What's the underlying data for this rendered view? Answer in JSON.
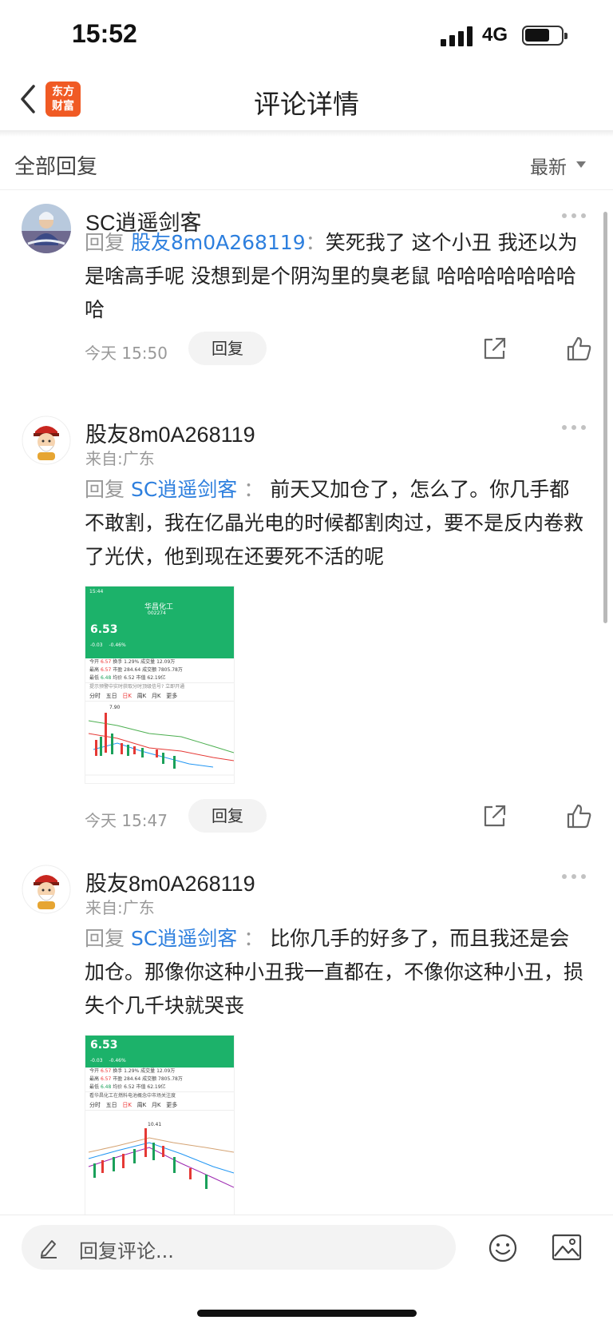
{
  "status_bar": {
    "time": "15:52",
    "network": "4G"
  },
  "nav": {
    "logo_line1": "东方",
    "logo_line2": "财富",
    "title": "评论详情"
  },
  "filter": {
    "all_label": "全部回复",
    "sort_label": "最新"
  },
  "comments": [
    {
      "username": "SC逍遥剑客",
      "location": "",
      "reply_prefix": "回复",
      "reply_target": "股友8m0A268119",
      "separator": "：",
      "text": "笑死我了 这个小丑 我还以为是啥高手呢 没想到是个阴沟里的臭老鼠 哈哈哈哈哈哈哈哈",
      "time": "今天 15:50",
      "reply_button": "回复"
    },
    {
      "username": "股友8m0A268119",
      "location": "来自:广东",
      "reply_prefix": "回复",
      "reply_target": "SC逍遥剑客",
      "separator": "：",
      "text": "前天又加仓了，怎么了。你几手都不敢割，我在亿晶光电的时候都割肉过，要不是反内卷救了光伏，他到现在还要死不活的呢",
      "time": "今天 15:47",
      "reply_button": "回复",
      "image": {
        "status_time": "15:44",
        "stock_name": "华昌化工",
        "stock_code": "002274",
        "price": "6.53",
        "change": "-0.03",
        "change_pct": "-0.46%",
        "rows": [
          [
            "今开",
            "6.57",
            "换手",
            "1.29%",
            "成交量",
            "12.09万"
          ],
          [
            "最高",
            "6.57",
            "市盈",
            "284.64",
            "成交额",
            "7805.78万"
          ],
          [
            "最低",
            "6.48",
            "均价",
            "6.52",
            "市值",
            "62.19亿"
          ]
        ],
        "notice": "提示预警中实时获取分时顶级信号? 立即开通",
        "tabs": [
          "分时",
          "五日",
          "日K",
          "周K",
          "月K",
          "更多"
        ],
        "peak": "7.90"
      }
    },
    {
      "username": "股友8m0A268119",
      "location": "来自:广东",
      "reply_prefix": "回复",
      "reply_target": "SC逍遥剑客",
      "separator": "：",
      "text": "比你几手的好多了，而且我还是会加仓。那像你这种小丑我一直都在，不像你这种小丑，损失个几千块就哭丧",
      "image": {
        "price": "6.53",
        "change": "-0.03",
        "change_pct": "-0.46%",
        "rows": [
          [
            "今开",
            "6.57",
            "换手",
            "1.29%",
            "成交量",
            "12.09万"
          ],
          [
            "最高",
            "6.57",
            "市盈",
            "284.64",
            "成交额",
            "7805.78万"
          ],
          [
            "最低",
            "6.48",
            "均价",
            "6.52",
            "市值",
            "62.19亿"
          ]
        ],
        "notice": "看华昌化工在燃料电池概念中市场关注度",
        "tabs": [
          "分时",
          "五日",
          "日K",
          "周K",
          "月K",
          "更多"
        ],
        "peak": "10.41"
      }
    }
  ],
  "bottom_bar": {
    "input_placeholder": "回复评论..."
  },
  "colors": {
    "link": "#2d7fde",
    "brand": "#f05a24",
    "stock_green": "#1cb26a"
  }
}
